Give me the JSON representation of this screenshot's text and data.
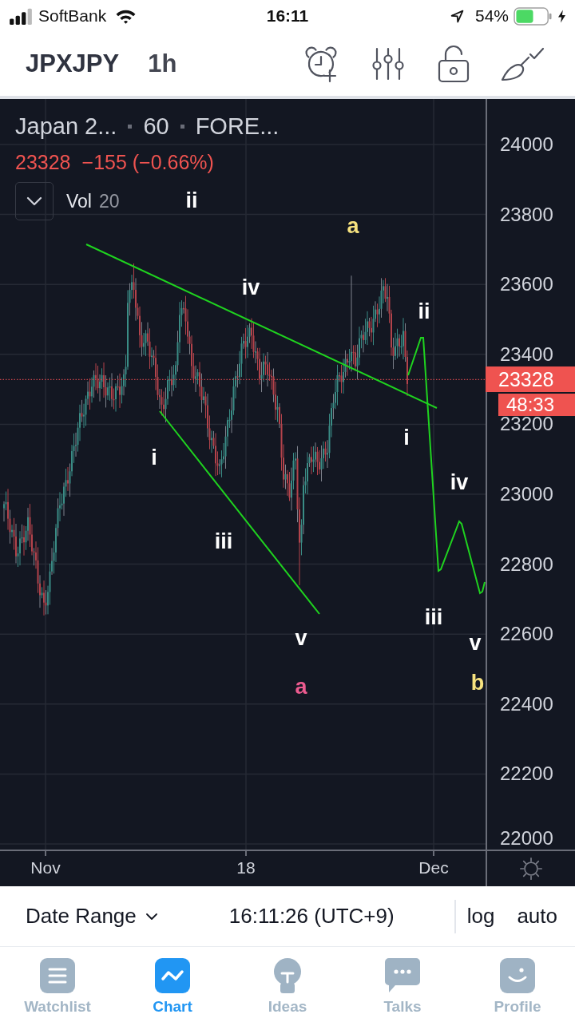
{
  "status_bar": {
    "carrier": "SoftBank",
    "time": "16:11",
    "battery": "54%"
  },
  "toolbar": {
    "symbol": "JPXJPY",
    "interval": "1h"
  },
  "chart": {
    "legend": {
      "name": "Japan 2...",
      "interval": "60",
      "source": "FORE...",
      "price": "23328",
      "change": "−155 (−0.66%)"
    },
    "indicator": {
      "name": "Vol",
      "value": "20"
    },
    "wave_labels": [
      {
        "text": "ii",
        "color": "#ffffff"
      },
      {
        "text": "a",
        "color": "#f6e27f"
      },
      {
        "text": "iv",
        "color": "#ffffff"
      },
      {
        "text": "ii",
        "color": "#ffffff"
      },
      {
        "text": "i",
        "color": "#ffffff"
      },
      {
        "text": "i",
        "color": "#ffffff"
      },
      {
        "text": "iv",
        "color": "#ffffff"
      },
      {
        "text": "iii",
        "color": "#ffffff"
      },
      {
        "text": "iii",
        "color": "#ffffff"
      },
      {
        "text": "v",
        "color": "#ffffff"
      },
      {
        "text": "v",
        "color": "#ffffff"
      },
      {
        "text": "a",
        "color": "#ec5b8f"
      },
      {
        "text": "b",
        "color": "#f6e27f"
      }
    ],
    "price_axis": [
      "24000",
      "23800",
      "23600",
      "23400",
      "23200",
      "23000",
      "22800",
      "22600",
      "22400",
      "22200",
      "22000"
    ],
    "last_price": "23328",
    "countdown": "48:33",
    "time_axis": [
      "Nov",
      "18",
      "Dec"
    ]
  },
  "bottom_bar": {
    "date_range": "Date Range",
    "clock": "16:11:26 (UTC+9)",
    "log": "log",
    "auto": "auto"
  },
  "tabs": [
    {
      "label": "Watchlist",
      "selected": false
    },
    {
      "label": "Chart",
      "selected": true
    },
    {
      "label": "Ideas",
      "selected": false
    },
    {
      "label": "Talks",
      "selected": false
    },
    {
      "label": "Profile",
      "selected": false
    }
  ]
}
